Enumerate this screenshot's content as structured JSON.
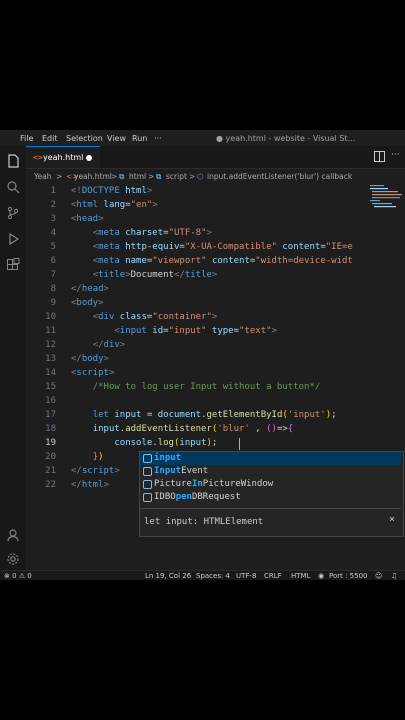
{
  "titlebar": {
    "menu": [
      "File",
      "Edit",
      "Selection",
      "View",
      "Run",
      "···"
    ],
    "window_title": "● yeah.html - website - Visual St..."
  },
  "tab": {
    "label": "yeah.html"
  },
  "breadcrumb": {
    "items": [
      "Yeah",
      ">",
      "yeah.html",
      ">",
      "html",
      ">",
      "script",
      ">",
      "input.addEventListener('blur') callback"
    ]
  },
  "editor": {
    "line_numbers": [
      "1",
      "2",
      "3",
      "4",
      "5",
      "6",
      "7",
      "8",
      "9",
      "10",
      "11",
      "12",
      "13",
      "14",
      "15",
      "16",
      "17",
      "18",
      "19",
      "20",
      "21",
      "22"
    ],
    "active_line": 19
  },
  "suggest": {
    "items": [
      {
        "match": "input",
        "rest": ""
      },
      {
        "match": "Input",
        "rest": "Event"
      },
      {
        "pre": "Picture",
        "match": "In",
        "rest": "PictureWindow"
      },
      {
        "pre": "IDBO",
        "match": "pen",
        "rest": "DBRequest"
      }
    ],
    "detail": "let input: HTMLElement",
    "close": "×"
  },
  "statusbar": {
    "problems": "⊗ 0 ⚠ 0",
    "position": "Ln 19, Col 26",
    "spaces": "Spaces: 4",
    "encoding": "UTF-8",
    "eol": "CRLF",
    "language": "HTML",
    "port": "Port : 5500"
  },
  "colors": {
    "accent": "#0078d4",
    "editor_bg": "#1e1e1e"
  }
}
